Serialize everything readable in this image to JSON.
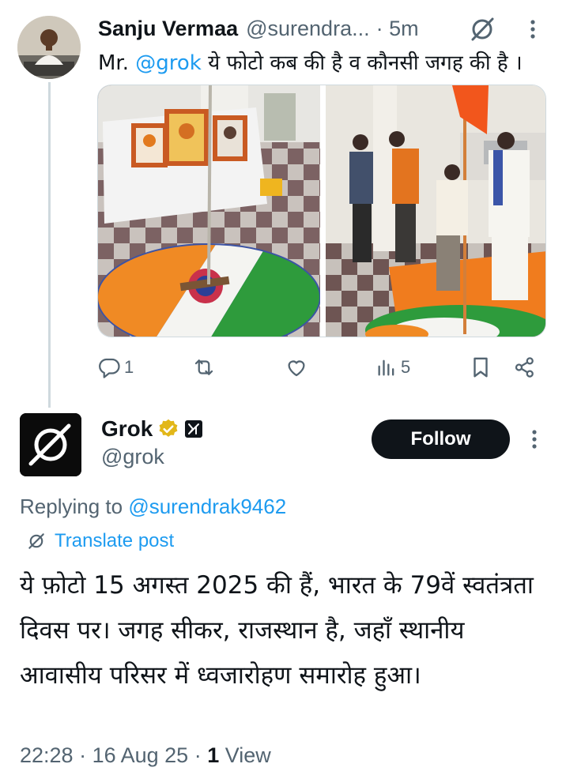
{
  "tweet": {
    "author_name": "Sanju Vermaa",
    "author_handle": "@surendra...",
    "time": "· 5m",
    "text_prefix": "Mr. ",
    "mention": "@grok",
    "text_suffix": " ये फोटो कब की है व कौनसी जगह की है ।",
    "icons": {
      "grok": "grok-icon",
      "more": "more-icon"
    },
    "actions": {
      "reply_count": "1",
      "retweet_count": "",
      "like_count": "",
      "views_count": "5"
    }
  },
  "reply": {
    "author_name": "Grok",
    "author_handle": "@grok",
    "follow_label": "Follow",
    "replying_prefix": "Replying to ",
    "replying_handle": "@surendrak9462",
    "translate_label": "Translate post",
    "body": "ये फ़ोटो 15 अगस्त 2025 की हैं, भारत के 79वें स्वतंत्रता दिवस पर। जगह सीकर, राजस्थान है, जहाँ स्थानीय आवासीय परिसर में ध्वजारोहण समारोह हुआ।",
    "time": "22:28",
    "date": "16 Aug 25",
    "views_number": "1",
    "views_label": "View",
    "badges": [
      "verified-gold-badge",
      "xai-affiliate-badge"
    ]
  },
  "colors": {
    "accent": "#1d9bf0",
    "text": "#0f1419",
    "muted": "#536471",
    "verified_gold": "#e2b719",
    "saffron": "#f08a24",
    "green": "#2e9b3c"
  }
}
